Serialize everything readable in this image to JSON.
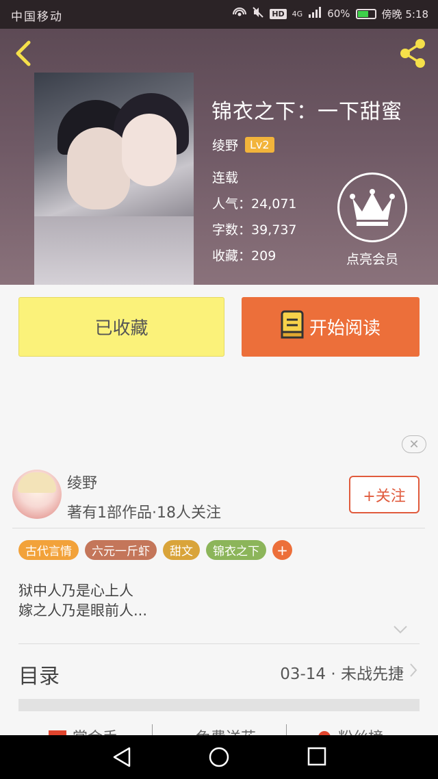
{
  "status_bar": {
    "carrier": "中国移动",
    "network": "4G",
    "hd": "HD",
    "battery": "60%",
    "time": "傍晚 5:18"
  },
  "book": {
    "title": "锦衣之下：一下甜蜜",
    "author": "绫野",
    "author_level": "Lv2",
    "status": "连载",
    "popularity_label": "人气：",
    "popularity": "24,071",
    "word_count_label": "字数：",
    "word_count": "39,737",
    "favorites_label": "收藏：",
    "favorites": "209",
    "member_label": "点亮会员"
  },
  "actions": {
    "favorited_label": "已收藏",
    "read_label": "开始阅读"
  },
  "ad": {
    "close_glyph": "✕"
  },
  "author_card": {
    "name": "绫野",
    "works": "著有1部作品·18人关注",
    "follow_label": "+关注"
  },
  "tags": [
    {
      "label": "古代言情",
      "color": "#f2a23a"
    },
    {
      "label": "六元一斤虾",
      "color": "#c4765a"
    },
    {
      "label": "甜文",
      "color": "#d9a43a"
    },
    {
      "label": "锦衣之下",
      "color": "#8cb55a"
    }
  ],
  "tag_add_label": "+",
  "synopsis": {
    "line1": "狱中人乃是心上人",
    "line2": "嫁之人乃是眼前人..."
  },
  "toc": {
    "label": "目录",
    "latest": "03-14 · 未战先捷"
  },
  "bottom_tabs": [
    {
      "label": "赏金手",
      "icon": "reward-icon"
    },
    {
      "label": "免费送花",
      "icon": "flower-icon"
    },
    {
      "label": "粉丝榜",
      "icon": "fans-icon"
    }
  ],
  "colors": {
    "accent_orange": "#ec6f3a",
    "favorite_yellow": "#fbf27a",
    "follow_red": "#e05a3c"
  }
}
